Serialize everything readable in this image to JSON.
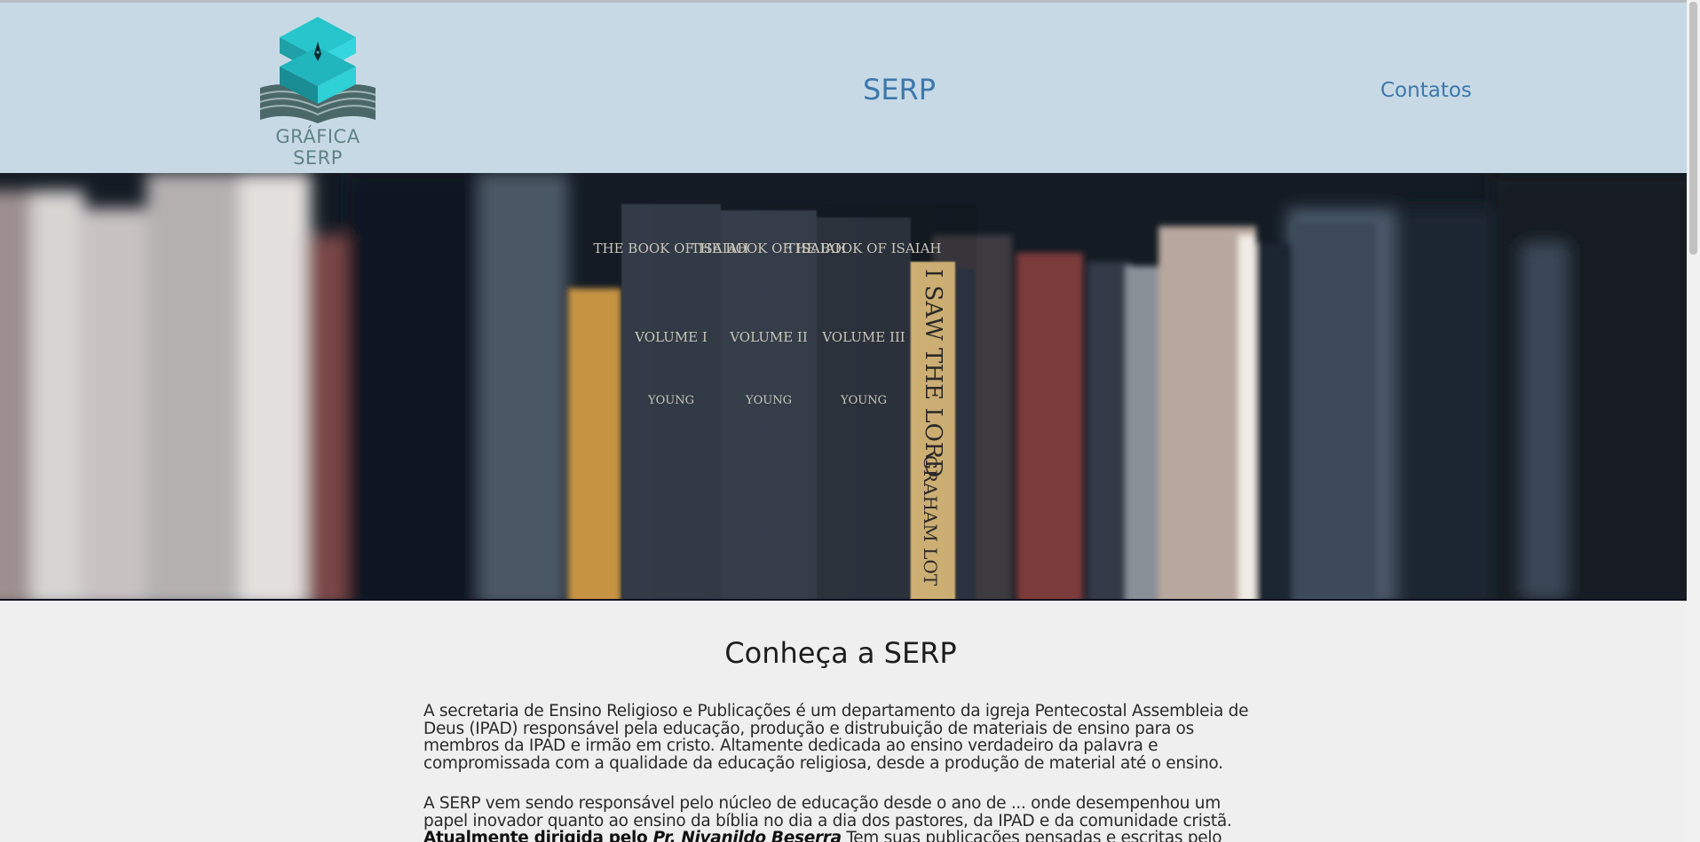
{
  "header": {
    "logo_text": "GRÁFICA SERP",
    "nav_serp": "SERP",
    "nav_contatos": "Contatos"
  },
  "hero": {
    "spine_1_title": "THE BOOK OF ISAIAH",
    "spine_1_volume": "VOLUME I",
    "spine_1_author": "YOUNG",
    "spine_2_title": "THE BOOK OF ISAIAH",
    "spine_2_volume": "VOLUME II",
    "spine_2_author": "YOUNG",
    "spine_3_title": "THE BOOK OF ISAIAH",
    "spine_3_volume": "VOLUME III",
    "spine_3_author": "YOUNG",
    "spine_4_title": "I SAW THE LORD",
    "spine_4_author": "GRAHAM LOT"
  },
  "main": {
    "title": "Conheça a SERP",
    "paragraph_1": "A secretaria de Ensino Religioso e Publicações é um departamento da igreja Pentecostal Assembleia de Deus (IPAD) responsável pela educação, produção e distrubuição de materiais de ensino para os membros da IPAD e irmão em cristo. Altamente dedicada ao ensino verdadeiro da palavra e compromissada com a qualidade da educação religiosa, desde a produção de material até o ensino.",
    "paragraph_2_text": "A SERP vem sendo responsável pelo núcleo de educação desde o ano de ... onde desempenhou um papel inovador quanto ao ensino da bíblia no dia a dia dos pastores, da IPAD e da comunidade cristã. ",
    "paragraph_2_bold": "Atualmente dirigida pelo ",
    "paragraph_2_italic": "Pr. Nivanildo Beserra",
    "paragraph_2_tail": " Tem suas publicações pensadas e escritas pelo Doutor"
  },
  "colors": {
    "header_bg": "#c8d9e6",
    "nav_link": "#3c78ac",
    "logo_teal": "#2bc1c8",
    "page_bg": "#efefef"
  }
}
